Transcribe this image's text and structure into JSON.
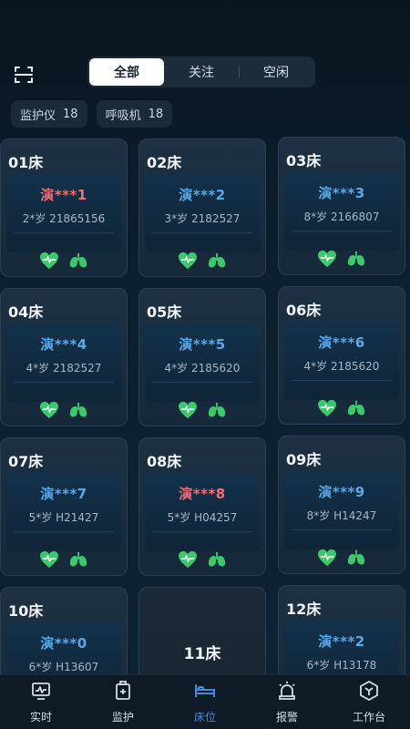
{
  "filter_tabs": [
    {
      "label": "全部",
      "active": true
    },
    {
      "label": "关注",
      "active": false
    },
    {
      "label": "空闲",
      "active": false
    }
  ],
  "chips": [
    {
      "label": "监护仪",
      "count": "18"
    },
    {
      "label": "呼吸机",
      "count": "18"
    }
  ],
  "beds": [
    {
      "bed": "01床",
      "name": "演***1",
      "info": "2*岁  21865156",
      "alert": true
    },
    {
      "bed": "02床",
      "name": "演***2",
      "info": "3*岁  2182527",
      "alert": false
    },
    {
      "bed": "03床",
      "name": "演***3",
      "info": "8*岁  2166807",
      "alert": false
    },
    {
      "bed": "04床",
      "name": "演***4",
      "info": "4*岁  2182527",
      "alert": false
    },
    {
      "bed": "05床",
      "name": "演***5",
      "info": "4*岁  2185620",
      "alert": false
    },
    {
      "bed": "06床",
      "name": "演***6",
      "info": "4*岁  2185620",
      "alert": false
    },
    {
      "bed": "07床",
      "name": "演***7",
      "info": "5*岁  H21427",
      "alert": false
    },
    {
      "bed": "08床",
      "name": "演***8",
      "info": "5*岁  H04257",
      "alert": true
    },
    {
      "bed": "09床",
      "name": "演***9",
      "info": "8*岁  H14247",
      "alert": false
    },
    {
      "bed": "10床",
      "name": "演***0",
      "info": "6*岁  H13607",
      "alert": false
    },
    {
      "bed": "11床",
      "name": "",
      "info": "",
      "alert": false,
      "empty": true
    },
    {
      "bed": "12床",
      "name": "演***2",
      "info": "6*岁  H13178",
      "alert": false
    }
  ],
  "bottom_tabs": [
    {
      "label": "实时",
      "icon": "monitor-wave-icon",
      "active": false
    },
    {
      "label": "监护",
      "icon": "medical-device-plus-icon",
      "active": false
    },
    {
      "label": "床位",
      "icon": "bed-icon",
      "active": true
    },
    {
      "label": "报警",
      "icon": "alarm-light-icon",
      "active": false
    },
    {
      "label": "工作台",
      "icon": "workbench-hexagon-icon",
      "active": false
    }
  ],
  "colors": {
    "accent": "#3f8ee0",
    "alert": "#ee6f77",
    "name_normal": "#5aa8e8",
    "device_green": "#3cc96b"
  }
}
